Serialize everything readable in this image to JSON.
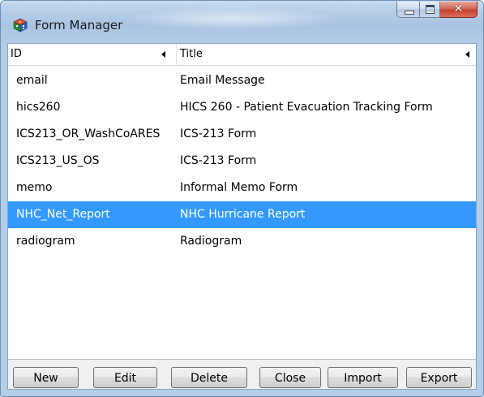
{
  "window": {
    "title": "Form Manager",
    "app_icon": "dice-cube-icon"
  },
  "caption_buttons": {
    "minimize_icon": "minimize-icon",
    "maximize_icon": "maximize-icon",
    "close_glyph": "✕",
    "close_icon": "close-icon"
  },
  "table": {
    "columns": [
      {
        "label": "ID",
        "sort_icon": "sort-arrow-left-icon"
      },
      {
        "label": "Title",
        "sort_icon": "sort-arrow-left-icon"
      }
    ],
    "rows": [
      {
        "id": "email",
        "title": "Email Message",
        "selected": false
      },
      {
        "id": "hics260",
        "title": "HICS 260 - Patient Evacuation Tracking Form",
        "selected": false
      },
      {
        "id": "ICS213_OR_WashCoARES",
        "title": "ICS-213 Form",
        "selected": false
      },
      {
        "id": "ICS213_US_OS",
        "title": "ICS-213 Form",
        "selected": false
      },
      {
        "id": "memo",
        "title": "Informal Memo Form",
        "selected": false
      },
      {
        "id": "NHC_Net_Report",
        "title": "NHC Hurricane Report",
        "selected": true
      },
      {
        "id": "radiogram",
        "title": "Radiogram",
        "selected": false
      }
    ]
  },
  "buttons": {
    "new": "New",
    "edit": "Edit",
    "delete": "Delete",
    "close": "Close",
    "import": "Import",
    "export": "Export"
  },
  "colors": {
    "selection": "#3399ff",
    "titlebar": "#b5cde6",
    "close_button": "#c4402c"
  }
}
